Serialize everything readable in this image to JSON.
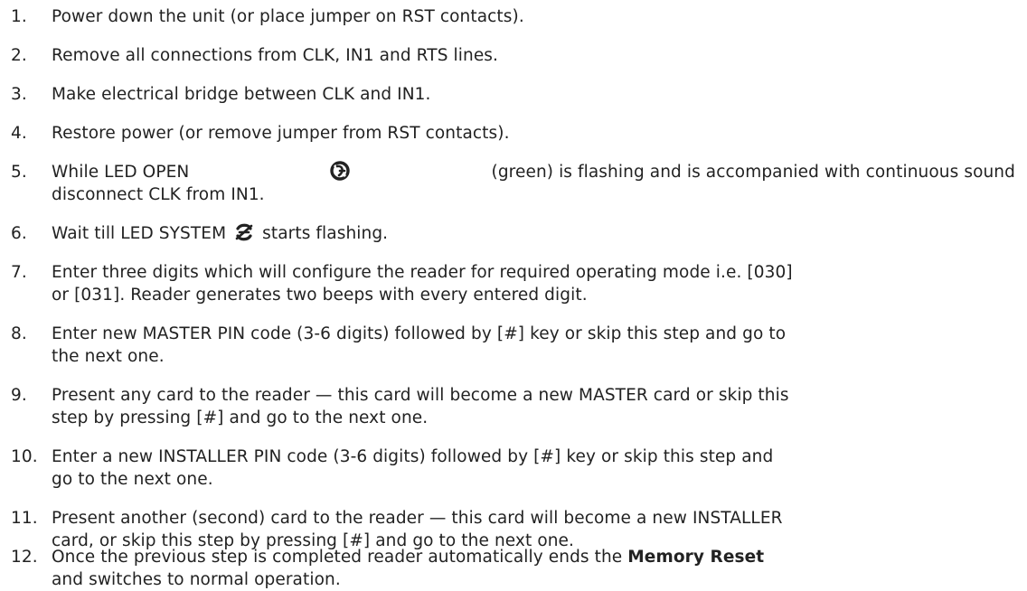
{
  "steps": [
    {
      "num": "1.",
      "text": "Power down the unit (or place jumper on RST contacts)."
    },
    {
      "num": "2.",
      "text": "Remove all connections from CLK, IN1 and RTS lines."
    },
    {
      "num": "3.",
      "text": "Make electrical bridge between CLK and IN1."
    },
    {
      "num": "4.",
      "text": "Restore power (or remove jumper from RST contacts)."
    },
    {
      "num": "5.",
      "before": "While LED OPEN",
      "icon": "led-open-icon",
      "after": "(green) is flashing and is accompanied with continuous sound",
      "line2": "disconnect CLK from IN1."
    },
    {
      "num": "6.",
      "before": "Wait till LED SYSTEM",
      "icon": "led-system-icon",
      "after": "starts flashing."
    },
    {
      "num": "7.",
      "line1": "Enter three digits which will configure the reader for required operating mode i.e. [030]",
      "line2": "or [031]. Reader generates two beeps with every entered digit."
    },
    {
      "num": "8.",
      "line1": "Enter new MASTER PIN code (3-6 digits) followed by [#] key or skip this step and go to",
      "line2": "the next one."
    },
    {
      "num": "9.",
      "line1": "Present any card to the reader — this card will become a new MASTER card or skip this",
      "line2": "step by pressing [#] and go to the next one."
    },
    {
      "num": "10.",
      "line1": "Enter a new INSTALLER PIN code (3-6 digits) followed by [#] key or skip this step and",
      "line2": "go to the next one."
    },
    {
      "num": "11.",
      "line1": "Present another (second) card to the reader — this card will become a new INSTALLER",
      "line2": "card, or skip this step by pressing [#] and go to the next one."
    },
    {
      "num": "12.",
      "before": "Once the previous step is completed reader automatically ends the",
      "bold": "Memory Reset",
      "line2": "and switches to normal operation."
    }
  ]
}
